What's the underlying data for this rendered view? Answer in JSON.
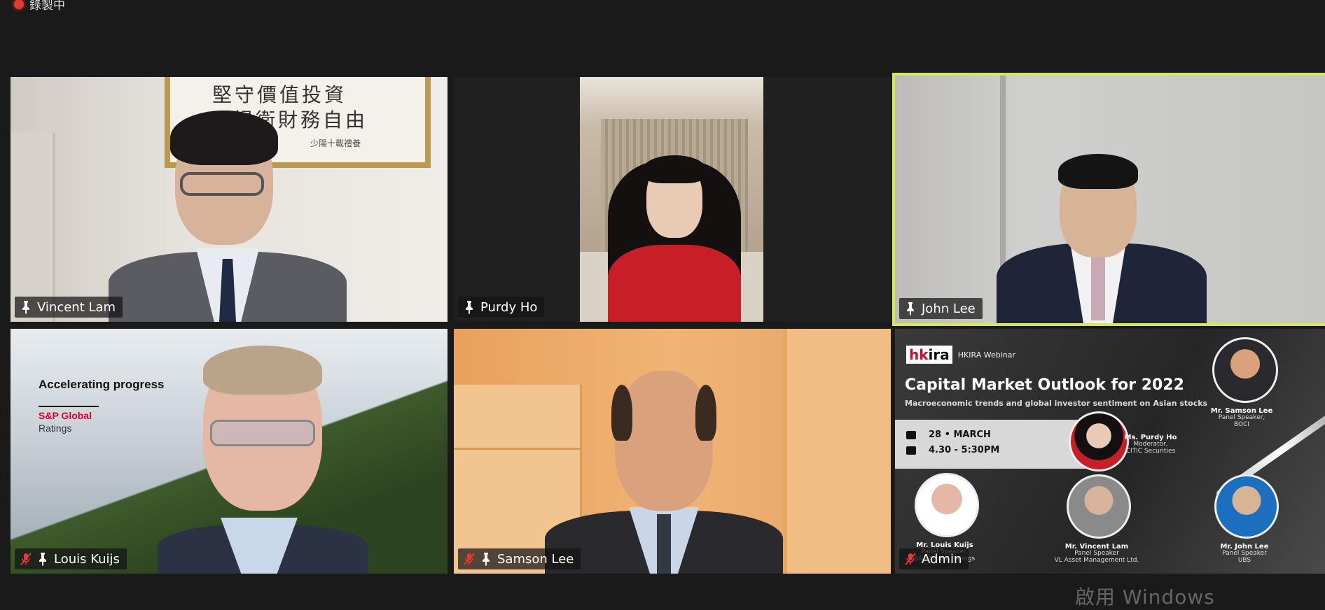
{
  "recording": {
    "label": "錄製中"
  },
  "participants": {
    "vincent": {
      "name": "Vincent Lam"
    },
    "purdy": {
      "name": "Purdy Ho"
    },
    "john": {
      "name": "John Lee"
    },
    "louis": {
      "name": "Louis Kuijs"
    },
    "samson": {
      "name": "Samson Lee"
    },
    "admin": {
      "name": "Admin"
    }
  },
  "vincent_bg": {
    "calligraphy_line1": "堅守價值投資",
    "calligraphy_line2": "揚衛財務自由",
    "calligraphy_sig": "少陽十載禮養"
  },
  "louis_bg": {
    "headline": "Accelerating progress",
    "brand": "S&P Global",
    "brand_sub": "Ratings"
  },
  "slide": {
    "logo_left": "hk",
    "logo_right": "ira",
    "subtitle": "HKIRA Webinar",
    "title": "Capital Market Outlook for 2022",
    "description": "Macroeconomic trends and global investor sentiment on Asian stocks",
    "date": "28 • MARCH",
    "time": "4.30 - 5:30PM",
    "samson_name": "Mr. Samson Lee",
    "samson_role": "Panel Speaker,",
    "samson_org": "BOCI",
    "purdy_name": "Ms. Purdy Ho",
    "purdy_role": "Moderator,",
    "purdy_org": "CITIC Securities",
    "louis_name": "Mr. Louis Kuijs",
    "louis_role": "Panel Speaker,",
    "louis_org": "S&P Global Ratings",
    "vincent_name": "Mr. Vincent Lam",
    "vincent_role": "Panel Speaker",
    "vincent_org": "VL Asset Management Ltd.",
    "john_name": "Mr. John Lee",
    "john_role": "Panel Speaker",
    "john_org": "UBS"
  },
  "watermark": {
    "text": "啟用 Windows"
  },
  "colors": {
    "active_speaker_border": "#d4e85a",
    "background": "#1a1a1a",
    "recording_dot": "#e53935"
  }
}
